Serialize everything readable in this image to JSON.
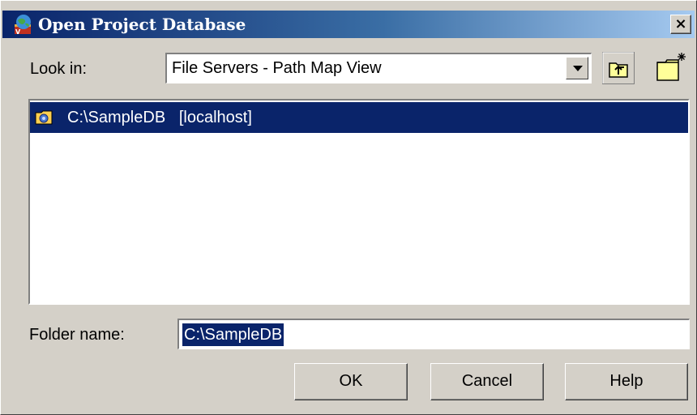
{
  "window": {
    "title": "Open Project Database",
    "title_icon": "database-globe-icon",
    "close_label": "×"
  },
  "lookin": {
    "label": "Look in:",
    "value": "File Servers - Path Map View",
    "dropdown_icon": "chevron-down-icon",
    "up_folder_icon": "up-one-level-icon",
    "new_folder_icon": "create-new-folder-icon"
  },
  "list": {
    "items": [
      {
        "text": "C:\\SampleDB   [localhost]",
        "icon": "database-folder-icon",
        "selected": true
      }
    ]
  },
  "folder": {
    "label": "Folder name:",
    "value": "C:\\SampleDB"
  },
  "buttons": {
    "ok": "OK",
    "cancel": "Cancel",
    "help": "Help"
  },
  "colors": {
    "face": "#d4d0c8",
    "selection": "#0a246a",
    "title_gradient_start": "#0a246a",
    "title_gradient_end": "#a6caf0"
  }
}
